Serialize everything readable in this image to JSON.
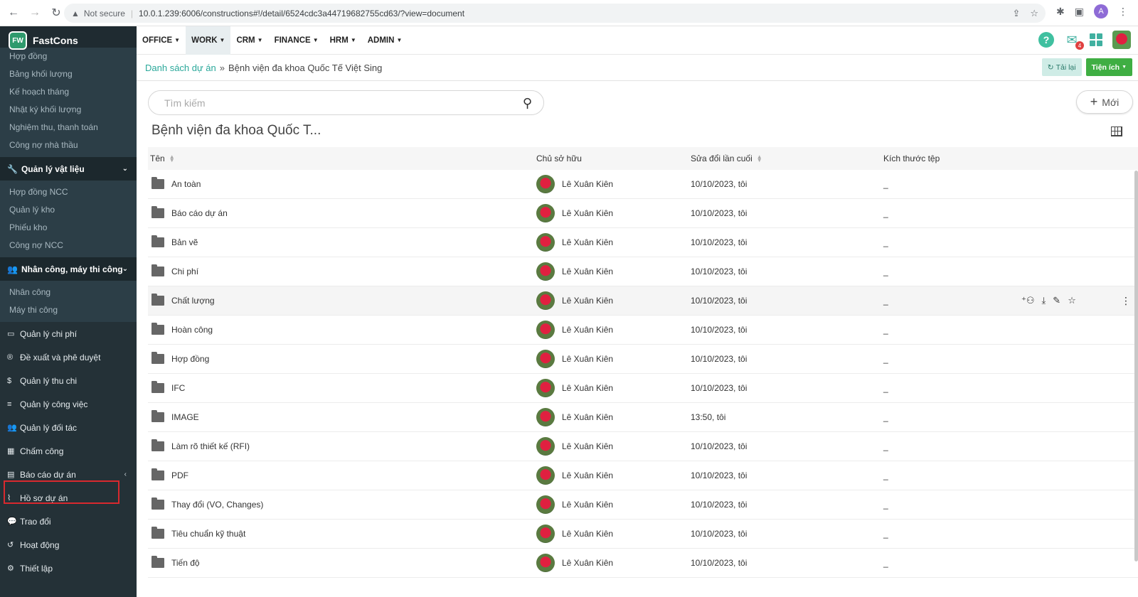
{
  "browser": {
    "security": "Not secure",
    "url": "10.0.1.239:6006/constructions#!/detail/6524cdc3a44719682755cd63/?view=document",
    "profile_initial": "A"
  },
  "app": {
    "name": "FastCons",
    "logo_text": "FW"
  },
  "sidebar": {
    "group1": [
      "Hợp đồng",
      "Bảng khối lượng",
      "Kế hoạch tháng",
      "Nhật ký khối lượng",
      "Nghiệm thu, thanh toán",
      "Công nợ nhà thầu"
    ],
    "section_materials": "Quản lý vật liệu",
    "group2": [
      "Hợp đồng NCC",
      "Quản lý kho",
      "Phiếu kho",
      "Công nợ NCC"
    ],
    "section_labor": "Nhân công, máy thi công",
    "group3": [
      "Nhân công",
      "Máy thi công"
    ],
    "menu": [
      {
        "label": "Quản lý chi phí",
        "icon": "card-icon"
      },
      {
        "label": "Đề xuất và phê duyệt",
        "icon": "registered-icon"
      },
      {
        "label": "Quản lý thu chi",
        "icon": "dollar-icon"
      },
      {
        "label": "Quản lý công việc",
        "icon": "list-icon"
      },
      {
        "label": "Quản lý đối tác",
        "icon": "users-icon"
      },
      {
        "label": "Chấm công",
        "icon": "calendar-icon"
      },
      {
        "label": "Báo cáo dự án",
        "icon": "book-icon"
      },
      {
        "label": "Hồ sơ dự án",
        "icon": "paperclip-icon"
      },
      {
        "label": "Trao đổi",
        "icon": "chat-icon"
      },
      {
        "label": "Hoạt động",
        "icon": "history-icon"
      },
      {
        "label": "Thiết lập",
        "icon": "gear-icon"
      }
    ]
  },
  "topnav": {
    "items": [
      "OFFICE",
      "WORK",
      "CRM",
      "FINANCE",
      "HRM",
      "ADMIN"
    ],
    "active": "WORK",
    "mail_count": "4"
  },
  "breadcrumb": {
    "parent": "Danh sách dự án",
    "current": "Bệnh viện đa khoa Quốc Tế Việt Sing",
    "reload": "Tải lại",
    "utilities": "Tiện ích"
  },
  "search": {
    "placeholder": "Tìm kiếm"
  },
  "new_button": "Mới",
  "folder_title": "Bệnh viện đa khoa Quốc T...",
  "table": {
    "headers": {
      "name": "Tên",
      "owner": "Chủ sở hữu",
      "modified": "Sửa đổi lần cuối",
      "size": "Kích thước tệp"
    },
    "rows": [
      {
        "name": "An toàn",
        "owner": "Lê Xuân Kiên",
        "modified": "10/10/2023, tôi",
        "size": "_"
      },
      {
        "name": "Báo cáo dự án",
        "owner": "Lê Xuân Kiên",
        "modified": "10/10/2023, tôi",
        "size": "_"
      },
      {
        "name": "Bản vẽ",
        "owner": "Lê Xuân Kiên",
        "modified": "10/10/2023, tôi",
        "size": "_"
      },
      {
        "name": "Chi phí",
        "owner": "Lê Xuân Kiên",
        "modified": "10/10/2023, tôi",
        "size": "_"
      },
      {
        "name": "Chất lượng",
        "owner": "Lê Xuân Kiên",
        "modified": "10/10/2023, tôi",
        "size": "_"
      },
      {
        "name": "Hoàn công",
        "owner": "Lê Xuân Kiên",
        "modified": "10/10/2023, tôi",
        "size": "_"
      },
      {
        "name": "Hợp đồng",
        "owner": "Lê Xuân Kiên",
        "modified": "10/10/2023, tôi",
        "size": "_"
      },
      {
        "name": "IFC",
        "owner": "Lê Xuân Kiên",
        "modified": "10/10/2023, tôi",
        "size": "_"
      },
      {
        "name": "IMAGE",
        "owner": "Lê Xuân Kiên",
        "modified": "13:50, tôi",
        "size": "_"
      },
      {
        "name": "Làm rõ thiết kế (RFI)",
        "owner": "Lê Xuân Kiên",
        "modified": "10/10/2023, tôi",
        "size": "_"
      },
      {
        "name": "PDF",
        "owner": "Lê Xuân Kiên",
        "modified": "10/10/2023, tôi",
        "size": "_"
      },
      {
        "name": "Thay đổi (VO, Changes)",
        "owner": "Lê Xuân Kiên",
        "modified": "10/10/2023, tôi",
        "size": "_"
      },
      {
        "name": "Tiêu chuẩn kỹ thuật",
        "owner": "Lê Xuân Kiên",
        "modified": "10/10/2023, tôi",
        "size": "_"
      },
      {
        "name": "Tiến độ",
        "owner": "Lê Xuân Kiên",
        "modified": "10/10/2023, tôi",
        "size": "_"
      }
    ],
    "hover_row_index": 4
  }
}
